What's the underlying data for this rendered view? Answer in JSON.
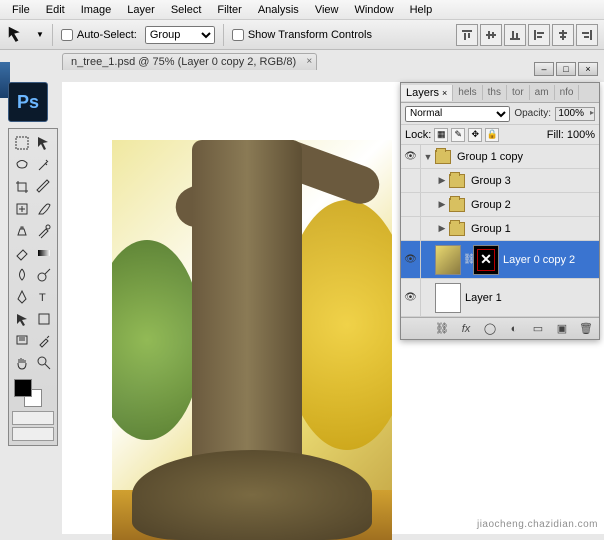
{
  "menu": [
    "File",
    "Edit",
    "Image",
    "Layer",
    "Select",
    "Filter",
    "Analysis",
    "View",
    "Window",
    "Help"
  ],
  "options": {
    "auto_select_label": "Auto-Select:",
    "auto_select_value": "Group",
    "show_transform_label": "Show Transform Controls"
  },
  "document": {
    "tab_title": "n_tree_1.psd @ 75% (Layer 0 copy 2, RGB/8)"
  },
  "brand": "Ps",
  "layers_panel": {
    "tabs": [
      "Layers",
      "hels",
      "ths",
      "tor",
      "am",
      "nfo"
    ],
    "blend_mode": "Normal",
    "opacity_label": "Opacity:",
    "opacity_value": "100%",
    "lock_label": "Lock:",
    "fill_label": "Fill:",
    "fill_value": "100%",
    "layers": [
      {
        "vis": true,
        "type": "group",
        "expanded": true,
        "indent": 0,
        "name": "Group 1 copy",
        "selected": false
      },
      {
        "vis": false,
        "type": "group",
        "expanded": false,
        "indent": 1,
        "name": "Group 3",
        "selected": false
      },
      {
        "vis": false,
        "type": "group",
        "expanded": false,
        "indent": 1,
        "name": "Group 2",
        "selected": false
      },
      {
        "vis": false,
        "type": "group",
        "expanded": false,
        "indent": 1,
        "name": "Group 1",
        "selected": false
      },
      {
        "vis": true,
        "type": "layer-mask",
        "indent": 1,
        "name": "Layer 0 copy 2",
        "selected": true
      },
      {
        "vis": true,
        "type": "layer",
        "indent": 0,
        "name": "Layer 1",
        "selected": false
      }
    ]
  },
  "watermark": "jiaocheng.chazidian.com"
}
